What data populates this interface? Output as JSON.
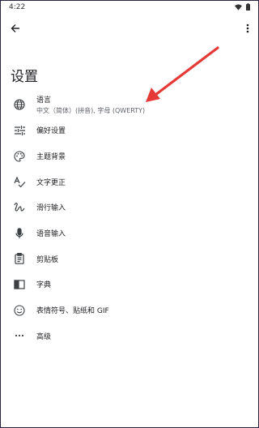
{
  "status_bar": {
    "time": "4:22"
  },
  "page_title": "设置",
  "items": [
    {
      "icon": "globe-icon",
      "label": "语言",
      "subtitle": "中文（简体）(拼音), 字母 (QWERTY)"
    },
    {
      "icon": "tune-icon",
      "label": "偏好设置"
    },
    {
      "icon": "palette-icon",
      "label": "主题背景"
    },
    {
      "icon": "spellcheck-icon",
      "label": "文字更正"
    },
    {
      "icon": "gesture-icon",
      "label": "滑行输入"
    },
    {
      "icon": "mic-icon",
      "label": "语音输入"
    },
    {
      "icon": "clipboard-icon",
      "label": "剪贴板"
    },
    {
      "icon": "dictionary-icon",
      "label": "字典"
    },
    {
      "icon": "emoji-icon",
      "label": "表情符号、贴纸和 GIF"
    },
    {
      "icon": "more-horiz-icon",
      "label": "高级"
    }
  ],
  "colors": {
    "annotation_arrow": "#e53935",
    "icon": "#3c4043"
  }
}
